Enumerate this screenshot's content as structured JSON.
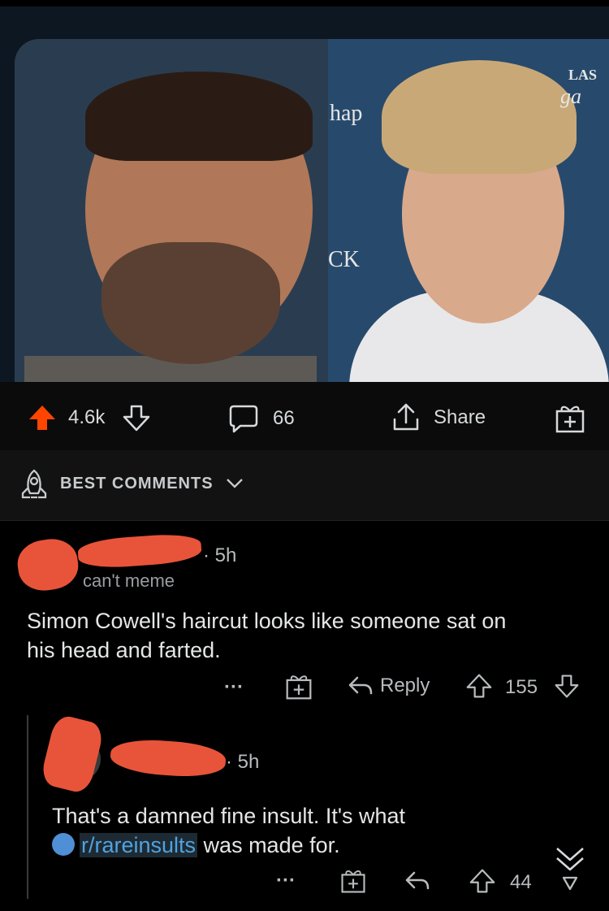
{
  "post": {
    "image_text": {
      "left": "hap",
      "left2": "CK",
      "right_logo": "LAS",
      "right_logo2": "ga"
    },
    "score": "4.6k",
    "comments_count": "66",
    "share_label": "Share"
  },
  "sort": {
    "label": "BEST COMMENTS"
  },
  "comments": [
    {
      "time": "· 5h",
      "flair": "can't meme",
      "text_line1": "Simon Cowell's haircut looks like someone sat on",
      "text_line2": "his head and farted.",
      "more": "···",
      "reply_label": "Reply",
      "score": "155"
    },
    {
      "time": "· 5h",
      "text_line1": "That's a damned fine insult. It's what",
      "subreddit_link": "r/rareinsults",
      "text_line2_rest": " was made for.",
      "more": "···",
      "score": "44"
    }
  ],
  "colors": {
    "upvote_active": "#ff4500",
    "link": "#4fa3e0",
    "background": "#000000",
    "redaction": "#e8543a"
  },
  "icons": [
    "upvote-icon",
    "downvote-icon",
    "comment-icon",
    "share-icon",
    "award-icon",
    "rocket-icon",
    "chevron-down-icon",
    "reply-icon",
    "collapse-icon"
  ]
}
